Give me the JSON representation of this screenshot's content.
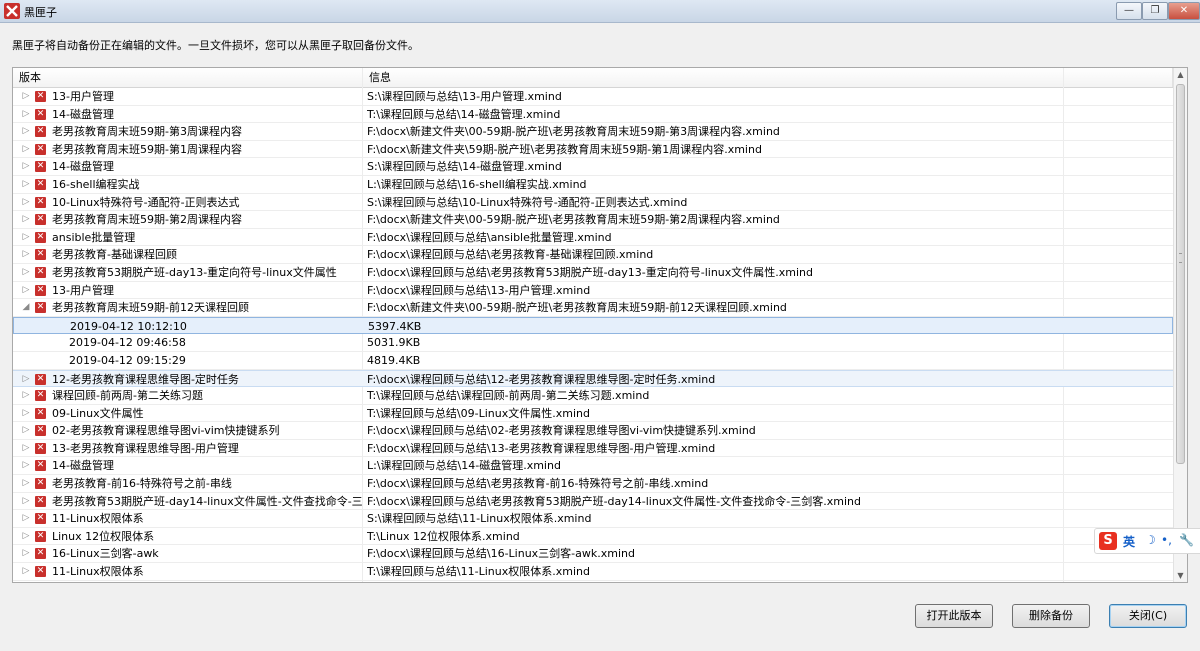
{
  "window": {
    "title": "黑匣子",
    "close_label": "✕",
    "maximize_label": "❐",
    "minimize_label": "—"
  },
  "hint": "黑匣子将自动备份正在编辑的文件。一旦文件损坏，您可以从黑匣子取回备份文件。",
  "columns": {
    "version": "版本",
    "info": "信息"
  },
  "rows": [
    {
      "type": "file",
      "expanded": false,
      "name": "13-用户管理",
      "info": "S:\\课程回顾与总结\\13-用户管理.xmind"
    },
    {
      "type": "file",
      "expanded": false,
      "name": "14-磁盘管理",
      "info": "T:\\课程回顾与总结\\14-磁盘管理.xmind"
    },
    {
      "type": "file",
      "expanded": false,
      "name": "老男孩教育周末班59期-第3周课程内容",
      "info": "F:\\docx\\新建文件夹\\00-59期-脱产班\\老男孩教育周末班59期-第3周课程内容.xmind"
    },
    {
      "type": "file",
      "expanded": false,
      "name": "老男孩教育周末班59期-第1周课程内容",
      "info": "F:\\docx\\新建文件夹\\59期-脱产班\\老男孩教育周末班59期-第1周课程内容.xmind"
    },
    {
      "type": "file",
      "expanded": false,
      "name": "14-磁盘管理",
      "info": "S:\\课程回顾与总结\\14-磁盘管理.xmind"
    },
    {
      "type": "file",
      "expanded": false,
      "name": "16-shell编程实战",
      "info": "L:\\课程回顾与总结\\16-shell编程实战.xmind"
    },
    {
      "type": "file",
      "expanded": false,
      "name": "10-Linux特殊符号-通配符-正则表达式",
      "info": "S:\\课程回顾与总结\\10-Linux特殊符号-通配符-正则表达式.xmind"
    },
    {
      "type": "file",
      "expanded": false,
      "name": "老男孩教育周末班59期-第2周课程内容",
      "info": "F:\\docx\\新建文件夹\\00-59期-脱产班\\老男孩教育周末班59期-第2周课程内容.xmind"
    },
    {
      "type": "file",
      "expanded": false,
      "name": "ansible批量管理",
      "info": "F:\\docx\\课程回顾与总结\\ansible批量管理.xmind"
    },
    {
      "type": "file",
      "expanded": false,
      "name": "老男孩教育-基础课程回顾",
      "info": "F:\\docx\\课程回顾与总结\\老男孩教育-基础课程回顾.xmind"
    },
    {
      "type": "file",
      "expanded": false,
      "name": "老男孩教育53期脱产班-day13-重定向符号-linux文件属性",
      "info": "F:\\docx\\课程回顾与总结\\老男孩教育53期脱产班-day13-重定向符号-linux文件属性.xmind"
    },
    {
      "type": "file",
      "expanded": false,
      "name": "13-用户管理",
      "info": "F:\\docx\\课程回顾与总结\\13-用户管理.xmind"
    },
    {
      "type": "file",
      "expanded": true,
      "name": "老男孩教育周末班59期-前12天课程回顾",
      "info": "F:\\docx\\新建文件夹\\00-59期-脱产班\\老男孩教育周末班59期-前12天课程回顾.xmind"
    },
    {
      "type": "version",
      "selected": true,
      "name": "2019-04-12 10:12:10",
      "info": "5397.4KB"
    },
    {
      "type": "version",
      "name": "2019-04-12 09:46:58",
      "info": "5031.9KB"
    },
    {
      "type": "version",
      "name": "2019-04-12 09:15:29",
      "info": "4819.4KB"
    },
    {
      "type": "file",
      "expanded": false,
      "hover": true,
      "name": "12-老男孩教育课程思维导图-定时任务",
      "info": "F:\\docx\\课程回顾与总结\\12-老男孩教育课程思维导图-定时任务.xmind"
    },
    {
      "type": "file",
      "expanded": false,
      "name": "课程回顾-前两周-第二关练习题",
      "info": "T:\\课程回顾与总结\\课程回顾-前两周-第二关练习题.xmind"
    },
    {
      "type": "file",
      "expanded": false,
      "name": "09-Linux文件属性",
      "info": "T:\\课程回顾与总结\\09-Linux文件属性.xmind"
    },
    {
      "type": "file",
      "expanded": false,
      "name": "02-老男孩教育课程思维导图vi-vim快捷键系列",
      "info": "F:\\docx\\课程回顾与总结\\02-老男孩教育课程思维导图vi-vim快捷键系列.xmind"
    },
    {
      "type": "file",
      "expanded": false,
      "name": "13-老男孩教育课程思维导图-用户管理",
      "info": "F:\\docx\\课程回顾与总结\\13-老男孩教育课程思维导图-用户管理.xmind"
    },
    {
      "type": "file",
      "expanded": false,
      "name": "14-磁盘管理",
      "info": "L:\\课程回顾与总结\\14-磁盘管理.xmind"
    },
    {
      "type": "file",
      "expanded": false,
      "name": "老男孩教育-前16-特殊符号之前-串线",
      "info": "F:\\docx\\课程回顾与总结\\老男孩教育-前16-特殊符号之前-串线.xmind"
    },
    {
      "type": "file",
      "expanded": false,
      "name": "老男孩教育53期脱产班-day14-linux文件属性-文件查找命令-三剑客",
      "info": "F:\\docx\\课程回顾与总结\\老男孩教育53期脱产班-day14-linux文件属性-文件查找命令-三剑客.xmind"
    },
    {
      "type": "file",
      "expanded": false,
      "name": "11-Linux权限体系",
      "info": "S:\\课程回顾与总结\\11-Linux权限体系.xmind"
    },
    {
      "type": "file",
      "expanded": false,
      "name": "Linux 12位权限体系",
      "info": "T:\\Linux 12位权限体系.xmind"
    },
    {
      "type": "file",
      "expanded": false,
      "name": "16-Linux三剑客-awk",
      "info": "F:\\docx\\课程回顾与总结\\16-Linux三剑客-awk.xmind"
    },
    {
      "type": "file",
      "expanded": false,
      "name": "11-Linux权限体系",
      "info": "T:\\课程回顾与总结\\11-Linux权限体系.xmind"
    }
  ],
  "buttons": {
    "open_version": "打开此版本",
    "delete_backup": "删除备份",
    "close": "关闭(C)"
  },
  "ime": {
    "logo": "S",
    "lang": "英"
  },
  "colors": {
    "file_icon": "#c8302c",
    "selected_row": "#e5effb",
    "ime_logo": "#e83020"
  }
}
